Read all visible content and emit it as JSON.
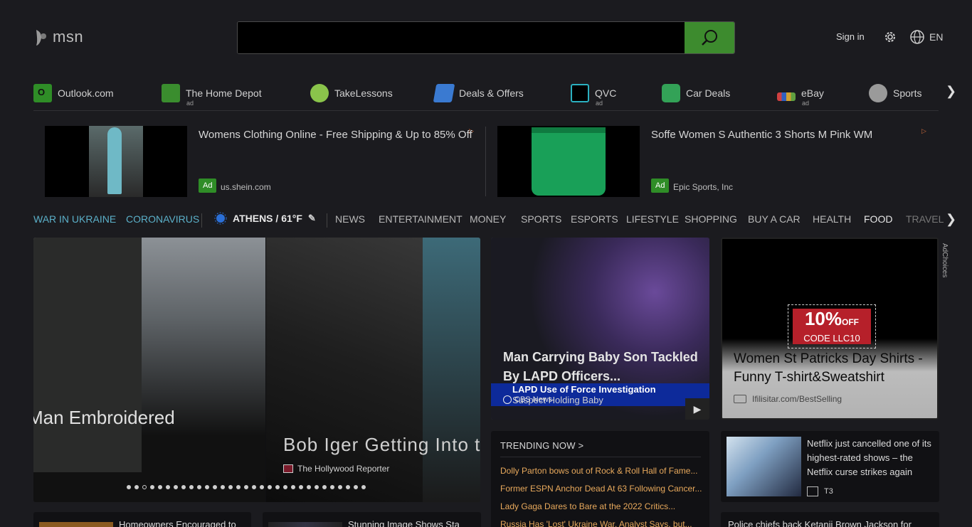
{
  "header": {
    "logo_text": "msn",
    "search_placeholder": "",
    "signin_label": "Sign in",
    "language": "EN"
  },
  "quicklinks": {
    "items": [
      {
        "label": "Outlook.com",
        "ad": "",
        "icon": "outlook-icon",
        "color": "#2f8d27"
      },
      {
        "label": "The Home Depot",
        "ad": "ad",
        "icon": "home-depot-icon",
        "color": "#3a8d2e"
      },
      {
        "label": "TakeLessons",
        "ad": "",
        "icon": "takelessons-icon",
        "color": "#8ac44b"
      },
      {
        "label": "Deals & Offers",
        "ad": "",
        "icon": "deals-icon",
        "color": "#3a7ad1"
      },
      {
        "label": "QVC",
        "ad": "ad",
        "icon": "qvc-icon",
        "color": "#2bb0c0"
      },
      {
        "label": "Car Deals",
        "ad": "",
        "icon": "car-icon",
        "color": "#33a257"
      },
      {
        "label": "eBay",
        "ad": "ad",
        "icon": "ebay-icon",
        "color": "#c8a040"
      },
      {
        "label": "Sports",
        "ad": "",
        "icon": "sports-icon",
        "color": "#a1a1a1"
      }
    ]
  },
  "ads": [
    {
      "title": "Womens Clothing Online - Free Shipping & Up to 85% Off",
      "badge": "Ad",
      "source": "us.shein.com"
    },
    {
      "title": "Soffe Women S Authentic 3 Shorts M Pink WM",
      "badge": "Ad",
      "source": "Epic Sports, Inc"
    }
  ],
  "nav": {
    "war": "WAR IN UKRAINE",
    "corona": "CORONAVIRUS",
    "weather": "ATHENS / 61°F",
    "items": [
      "NEWS",
      "ENTERTAINMENT",
      "MONEY",
      "SPORTS",
      "ESPORTS",
      "LIFESTYLE",
      "SHOPPING",
      "BUY A CAR",
      "HEALTH",
      "FOOD",
      "TRAVEL"
    ]
  },
  "hero": {
    "left_title": "Man Embroidered",
    "right_title": "Bob Iger Getting Into t",
    "right_source": "The Hollywood Reporter",
    "dots_count": 31,
    "active_dot": 2
  },
  "video_card": {
    "title": "Man Carrying Baby Son Tackled By LAPD Officers...",
    "banner1": "LAPD Use of Force Investigation",
    "banner2": "Suspect Holding Baby",
    "source": "CBS News"
  },
  "ad_card": {
    "coupon_big": "10%",
    "coupon_off": "OFF",
    "coupon_code": "CODE LLC10",
    "title": "Women St Patricks Day Shirts - Funny T-shirt&Sweatshirt",
    "source": "Ifilisitar.com/BestSelling",
    "adchoices": "AdChoices"
  },
  "trending": {
    "heading": "TRENDING NOW >",
    "items": [
      "Dolly Parton bows out of Rock & Roll Hall of Fame...",
      "Former ESPN Anchor Dead At 63 Following Cancer...",
      "Lady Gaga Dares to Bare at the 2022 Critics...",
      "Russia Has 'Lost' Ukraine War, Analyst Says, but..."
    ]
  },
  "netflix_card": {
    "title": "Netflix just cancelled one of its highest-rated shows – the Netflix curse strikes again",
    "source": "T3"
  },
  "bottom": {
    "card1": "Homeowners Encouraged to",
    "card2": "Stunning Image Shows Sta",
    "card3": "Police chiefs back Ketanji Brown Jackson for"
  }
}
